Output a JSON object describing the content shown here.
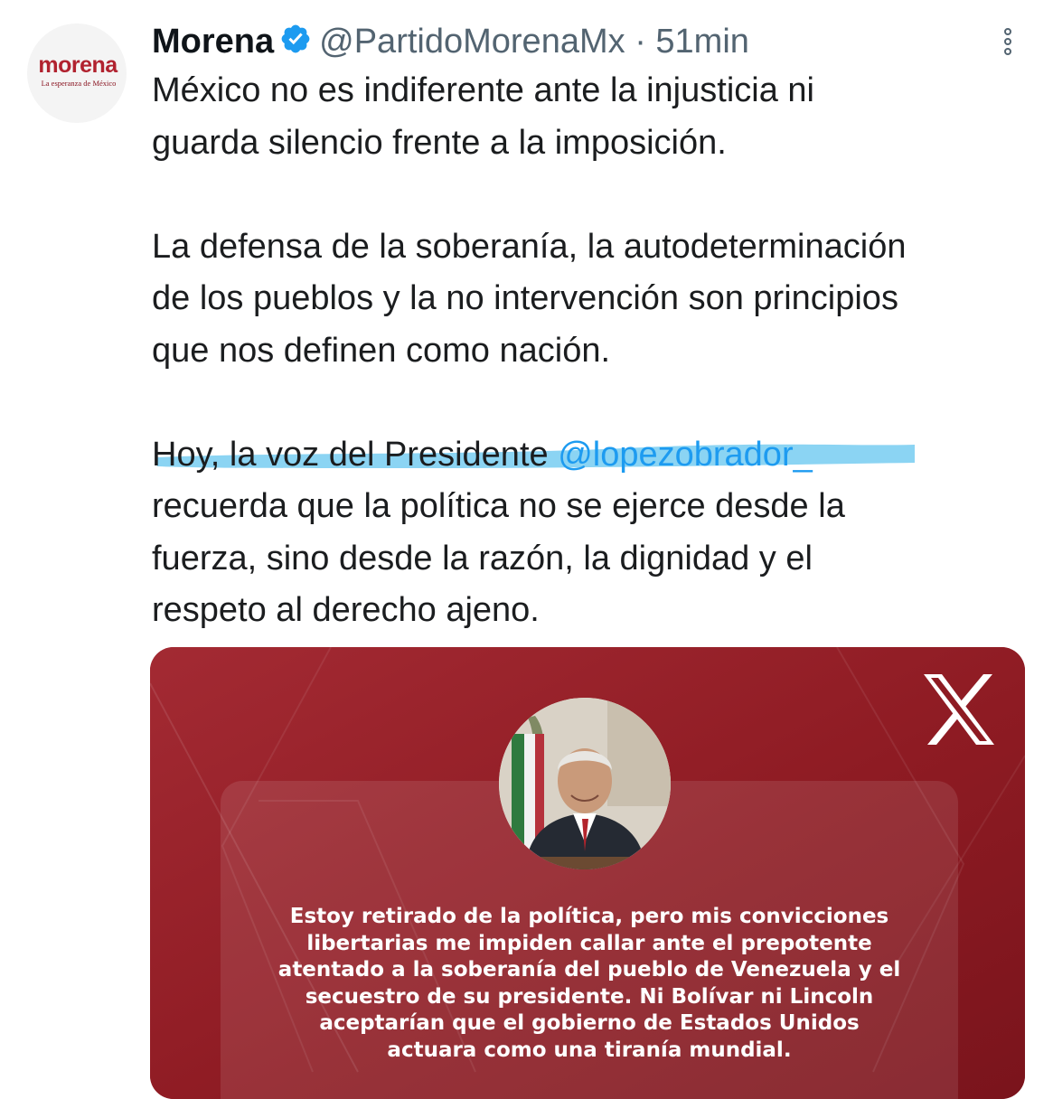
{
  "author": {
    "name": "Morena",
    "handle": "@PartidoMorenaMx",
    "separator": "·",
    "time": "51min",
    "avatar": {
      "word": "morena",
      "tagline": "La esperanza de México",
      "brand_color": "#b1222f"
    },
    "verified_color": "#1d9bf0"
  },
  "tweet": {
    "paragraph1": {
      "line1": "México no es indiferente ante la injusticia ni",
      "line2": "guarda silencio frente a la imposición."
    },
    "paragraph2": {
      "line1": "La defensa de la soberanía, la autodeterminación",
      "line2": "de los pueblos y la no intervención son principios",
      "line3": "que nos definen como nación."
    },
    "paragraph3": {
      "line1_prefix": "Hoy, la voz del Presidente ",
      "mention": "@lopezobrador_",
      "line2": "recuerda que la política no se ejerce desde la",
      "line3": "fuerza, sino desde la razón, la dignidad y el",
      "line4": "respeto al derecho ajeno."
    },
    "mention_color": "#1d9bf0",
    "highlight_color": "#5ec4ee"
  },
  "media": {
    "card_color": "#8e1b23",
    "logo": "x-logo",
    "quote": "Estoy retirado de la política, pero mis convicciones\nlibertarias me impiden callar ante el prepotente\natentado a la soberanía del pueblo de Venezuela y el\nsecuestro de su presidente. Ni Bolívar ni Lincoln\naceptarían que el gobierno de Estados Unidos\nactuara como una tiranía mundial."
  }
}
